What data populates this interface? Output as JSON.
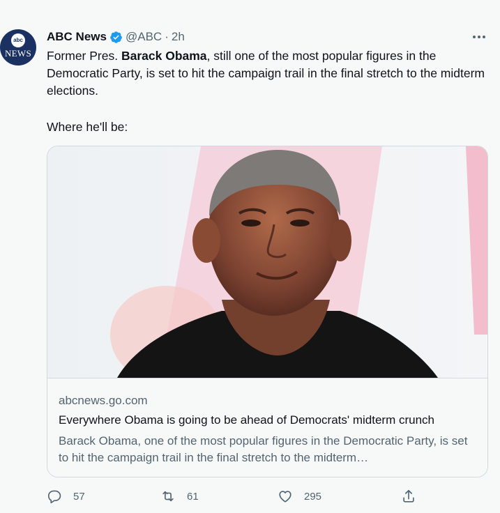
{
  "author": {
    "name": "ABC News",
    "handle": "@ABC",
    "separator": "·",
    "time": "2h",
    "avatar_text_small": "abc",
    "avatar_text_large": "NEWS"
  },
  "tweet": {
    "text_prefix": "Former Pres. ",
    "text_bold": "Barack Obama",
    "text_suffix": ", still one of the most popular figures in the Democratic Party, is set to hit the campaign trail in the final stretch to the midterm elections.",
    "text_line2": "Where he'll be:"
  },
  "card": {
    "domain": "abcnews.go.com",
    "title": "Everywhere Obama is going to be ahead of Democrats' midterm crunch",
    "description": "Barack Obama, one of the most popular figures in the Democratic Party, is set to hit the campaign trail in the final stretch to the midterm…"
  },
  "actions": {
    "replies": "57",
    "retweets": "61",
    "likes": "295"
  },
  "icons": {
    "verified": "verified-badge-icon",
    "more": "more-icon",
    "reply": "reply-icon",
    "retweet": "retweet-icon",
    "like": "like-icon",
    "share": "share-icon"
  },
  "colors": {
    "verified": "#1d9bf0",
    "muted": "#536471",
    "text": "#0f1419",
    "avatar_bg": "#1a3162"
  }
}
